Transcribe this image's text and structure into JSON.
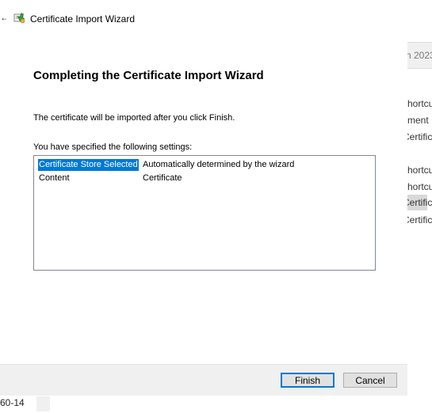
{
  "window": {
    "title": "Certificate Import Wizard",
    "back_glyph": "←"
  },
  "main": {
    "heading": "Completing the Certificate Import Wizard",
    "description": "The certificate will be imported after you click Finish.",
    "settings_label": "You have specified the following settings:",
    "settings": [
      {
        "key": "Certificate Store Selected",
        "value": "Automatically determined by the wizard"
      },
      {
        "key": "Content",
        "value": "Certificate"
      }
    ]
  },
  "footer": {
    "finish_label": "Finish",
    "cancel_label": "Cancel"
  },
  "background": {
    "right_date": "h 2023",
    "right_items": [
      "hortcu",
      "ment",
      "Certific",
      "hortcu",
      "hortcu",
      "Certific",
      "Certific"
    ],
    "bottom_code": "60-14"
  },
  "colors": {
    "selection": "#0078d7",
    "footer_bg": "#f0f0f0",
    "button_bg": "#e1e1e1"
  }
}
